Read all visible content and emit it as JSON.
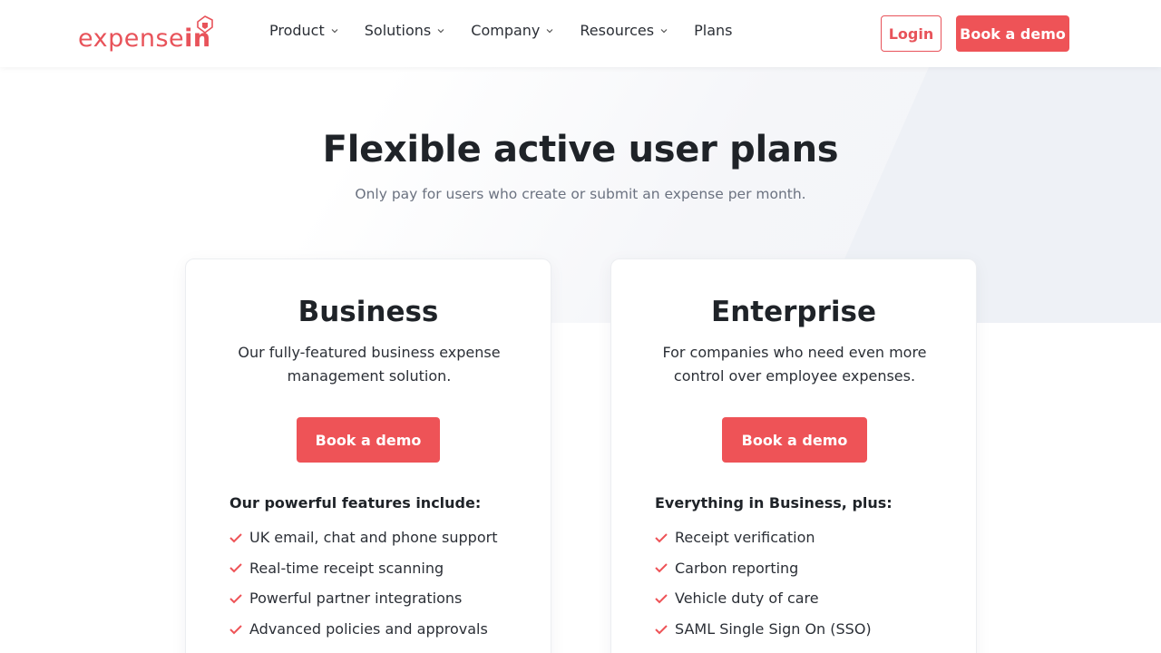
{
  "brand": {
    "name_light": "expense",
    "name_bold": "in",
    "accent": "#ee5357"
  },
  "nav": [
    {
      "label": "Product",
      "has_menu": true
    },
    {
      "label": "Solutions",
      "has_menu": true
    },
    {
      "label": "Company",
      "has_menu": true
    },
    {
      "label": "Resources",
      "has_menu": true
    },
    {
      "label": "Plans",
      "has_menu": false
    }
  ],
  "header": {
    "login_label": "Login",
    "demo_label": "Book a demo"
  },
  "hero": {
    "title": "Flexible active user plans",
    "subtitle": "Only pay for users who create or submit an expense per month."
  },
  "plans": [
    {
      "name": "Business",
      "description": "Our fully-featured business expense management solution.",
      "button": "Book a demo",
      "features_heading": "Our powerful features include:",
      "features": [
        "UK email, chat and phone support",
        "Real-time receipt scanning",
        "Powerful partner integrations",
        "Advanced policies and approvals"
      ]
    },
    {
      "name": "Enterprise",
      "description": "For companies who need even more control over employee expenses.",
      "button": "Book a demo",
      "features_heading": "Everything in Business, plus:",
      "features": [
        "Receipt verification",
        "Carbon reporting",
        "Vehicle duty of care",
        "SAML Single Sign On (SSO)"
      ]
    }
  ]
}
